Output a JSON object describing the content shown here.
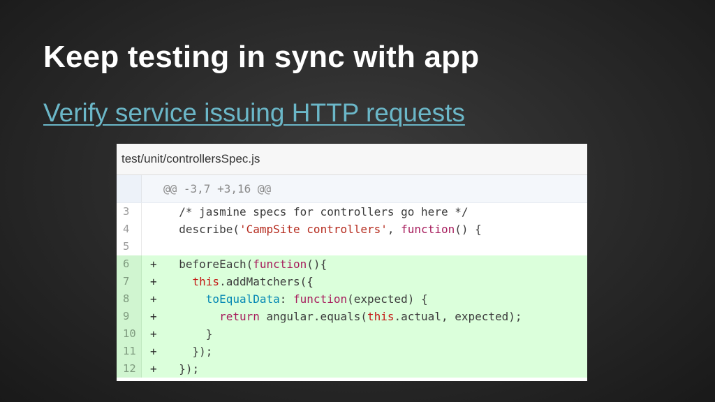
{
  "slide": {
    "title": "Keep testing in sync with app",
    "subtitle": "Verify service issuing HTTP requests"
  },
  "diff": {
    "file_name": "test/unit/controllersSpec.js",
    "hunk_header": "@@ -3,7 +3,16 @@",
    "lines": [
      {
        "number": "3",
        "type": "context",
        "marker": "",
        "tokens": [
          {
            "t": "  /* jasmine specs for controllers go here */",
            "c": "cm"
          }
        ]
      },
      {
        "number": "4",
        "type": "context",
        "marker": "",
        "tokens": [
          {
            "t": "  describe(",
            "c": "fn"
          },
          {
            "t": "'CampSite controllers'",
            "c": "str"
          },
          {
            "t": ", ",
            "c": "fn"
          },
          {
            "t": "function",
            "c": "kw"
          },
          {
            "t": "() {",
            "c": "fn"
          }
        ]
      },
      {
        "number": "5",
        "type": "context",
        "marker": "",
        "tokens": []
      },
      {
        "number": "6",
        "type": "add",
        "marker": "+",
        "tokens": [
          {
            "t": "  beforeEach(",
            "c": "fn"
          },
          {
            "t": "function",
            "c": "kw"
          },
          {
            "t": "(){",
            "c": "fn"
          }
        ]
      },
      {
        "number": "7",
        "type": "add",
        "marker": "+",
        "tokens": [
          {
            "t": "    ",
            "c": "fn"
          },
          {
            "t": "this",
            "c": "this"
          },
          {
            "t": ".addMatchers({",
            "c": "fn"
          }
        ]
      },
      {
        "number": "8",
        "type": "add",
        "marker": "+",
        "tokens": [
          {
            "t": "      ",
            "c": "fn"
          },
          {
            "t": "toEqualData",
            "c": "prop"
          },
          {
            "t": ": ",
            "c": "fn"
          },
          {
            "t": "function",
            "c": "kw"
          },
          {
            "t": "(expected) {",
            "c": "fn"
          }
        ]
      },
      {
        "number": "9",
        "type": "add",
        "marker": "+",
        "tokens": [
          {
            "t": "        ",
            "c": "fn"
          },
          {
            "t": "return",
            "c": "kw"
          },
          {
            "t": " angular.equals(",
            "c": "fn"
          },
          {
            "t": "this",
            "c": "this"
          },
          {
            "t": ".actual, expected);",
            "c": "fn"
          }
        ]
      },
      {
        "number": "10",
        "type": "add",
        "marker": "+",
        "tokens": [
          {
            "t": "      }",
            "c": "fn"
          }
        ]
      },
      {
        "number": "11",
        "type": "add",
        "marker": "+",
        "tokens": [
          {
            "t": "    });",
            "c": "fn"
          }
        ]
      },
      {
        "number": "12",
        "type": "add",
        "marker": "+",
        "tokens": [
          {
            "t": "  });",
            "c": "fn"
          }
        ]
      }
    ]
  },
  "colors": {
    "title": "#ffffff",
    "subtitle": "#6bb7c8",
    "added_line_bg": "#dbffdb",
    "keyword": "#a71d5d",
    "string": "#b52a1d",
    "property": "#0086b3"
  }
}
